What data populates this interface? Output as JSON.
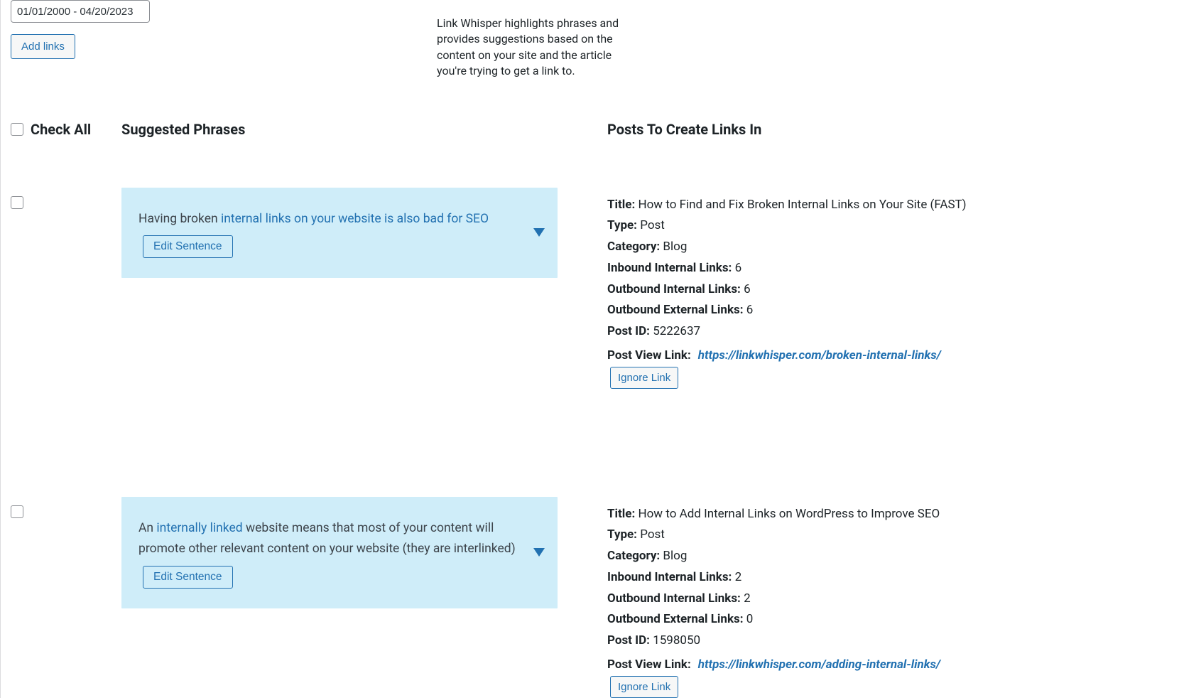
{
  "top": {
    "date_value": "01/01/2000 - 04/20/2023",
    "add_links_label": "Add links",
    "help_text": "Link Whisper highlights phrases and provides suggestions based on the content on your site and the article you're trying to get a link to."
  },
  "headers": {
    "check_all": "Check All",
    "suggested": "Suggested Phrases",
    "posts_in": "Posts To Create Links In"
  },
  "labels": {
    "edit_sentence": "Edit Sentence",
    "ignore_link": "Ignore Link",
    "title": "Title: ",
    "type": "Type: ",
    "category": "Category: ",
    "inbound": "Inbound Internal Links: ",
    "outbound_int": "Outbound Internal Links: ",
    "outbound_ext": "Outbound External Links: ",
    "post_id": "Post ID: ",
    "post_view_link": "Post View Link: "
  },
  "rows": [
    {
      "sentence_pre": "Having broken ",
      "sentence_link": "internal links on your website is also bad for SEO",
      "sentence_post": "",
      "post": {
        "title": "How to Find and Fix Broken Internal Links on Your Site (FAST)",
        "type": "Post",
        "category": "Blog",
        "inbound": "6",
        "outbound_int": "6",
        "outbound_ext": "6",
        "post_id": "5222637",
        "view_link": "https://linkwhisper.com/broken-internal-links/"
      }
    },
    {
      "sentence_pre": "An ",
      "sentence_link": "internally linked",
      "sentence_post": " website means that most of your content will promote other relevant content on your website (they are interlinked)",
      "post": {
        "title": "How to Add Internal Links on WordPress to Improve SEO",
        "type": "Post",
        "category": "Blog",
        "inbound": "2",
        "outbound_int": "2",
        "outbound_ext": "0",
        "post_id": "1598050",
        "view_link": "https://linkwhisper.com/adding-internal-links/"
      }
    }
  ]
}
